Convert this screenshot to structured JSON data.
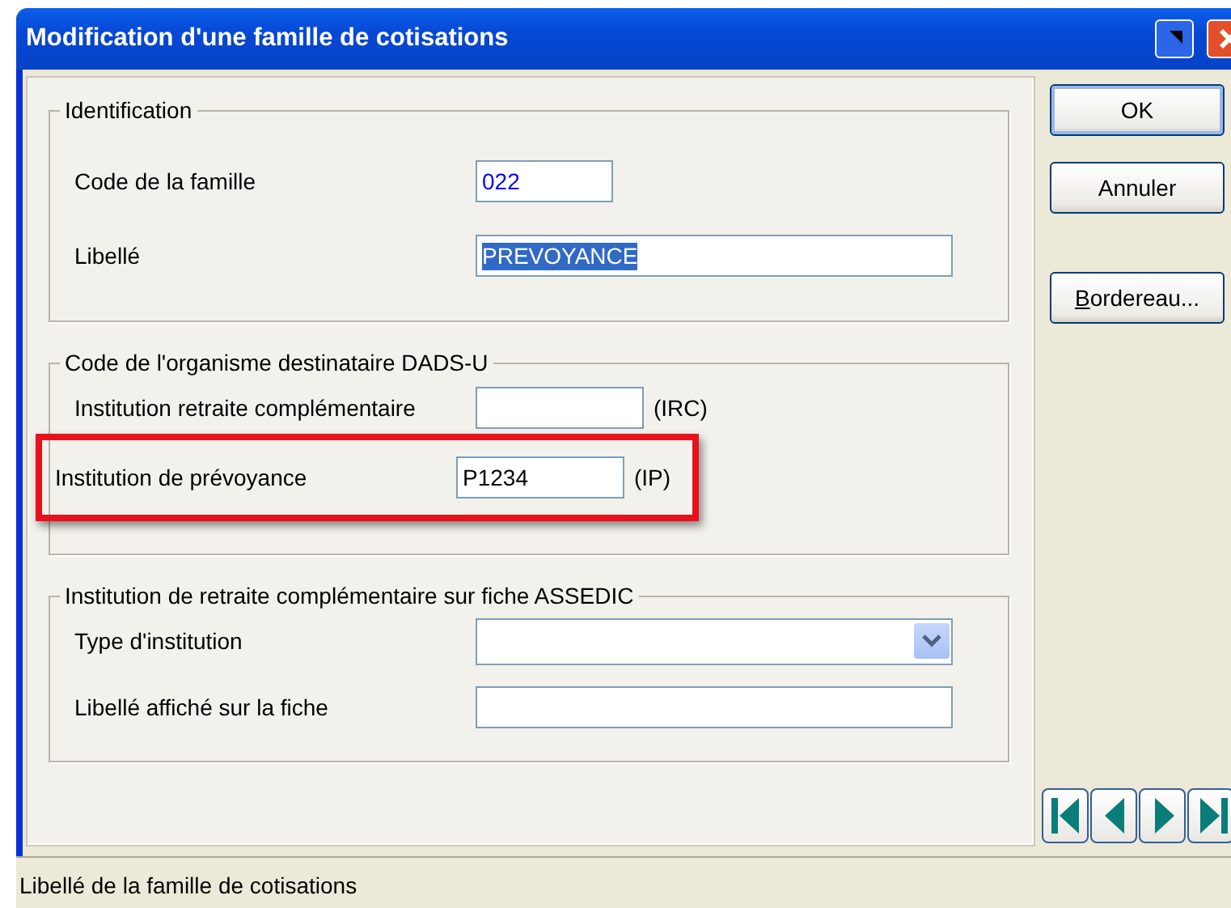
{
  "window": {
    "title": "Modification d'une famille de cotisations"
  },
  "groups": [
    {
      "legend": "Identification",
      "rows": [
        {
          "kind": "text",
          "label": "Code de la famille",
          "value": "022",
          "color": "#0000ff",
          "highlighted": false
        },
        {
          "kind": "text",
          "label": "Libellé",
          "value": "PREVOYANCE",
          "text_selected": true,
          "highlighted": false
        }
      ]
    },
    {
      "legend": "Code de l'organisme destinataire DADS-U",
      "rows": [
        {
          "kind": "text",
          "label": "Institution retraite complémentaire",
          "suffix": "(IRC)",
          "highlighted": false
        },
        {
          "kind": "text",
          "label": "Institution de prévoyance",
          "value": "P1234",
          "suffix": "(IP)",
          "text_selected": false,
          "highlighted": true
        }
      ]
    },
    {
      "legend": "Institution de retraite complémentaire sur fiche ASSEDIC",
      "rows": [
        {
          "kind": "select",
          "label": "Type d'institution",
          "highlighted": false
        },
        {
          "kind": "text",
          "label": "Libellé affiché sur la fiche",
          "highlighted": false
        }
      ]
    }
  ],
  "buttons": [
    {
      "label": "OK",
      "default": true,
      "mnemonic": false
    },
    {
      "label": "Annuler",
      "default": false,
      "mnemonic": false
    },
    {
      "label": "Bordereau...",
      "default": false,
      "mnemonic": true
    }
  ],
  "status_bar": "Libellé de la famille de cotisations"
}
